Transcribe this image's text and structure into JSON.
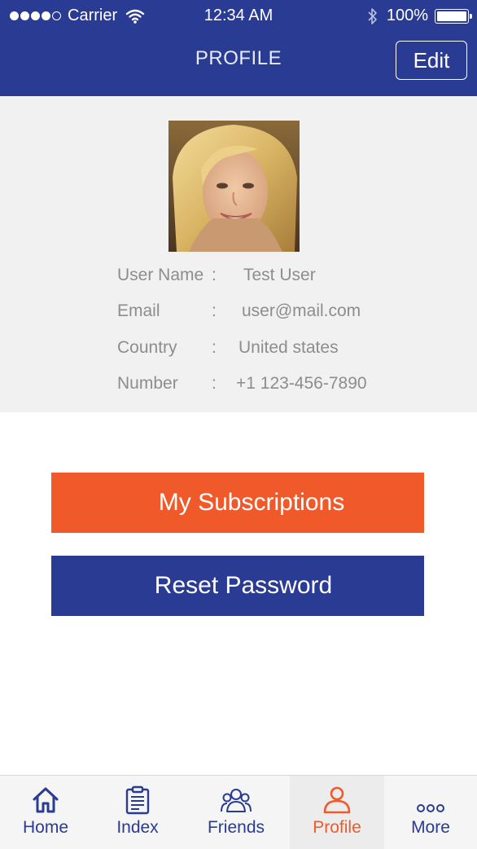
{
  "status_bar": {
    "carrier": "Carrier",
    "time": "12:34 AM",
    "battery": "100%"
  },
  "header": {
    "title": "PROFILE",
    "edit_label": "Edit"
  },
  "profile": {
    "fields": [
      {
        "label": "User Name",
        "sep": ":",
        "value": "Test User"
      },
      {
        "label": "Email",
        "sep": ":",
        "value": "user@mail.com"
      },
      {
        "label": "Country",
        "sep": ":",
        "value": "United states"
      },
      {
        "label": "Number",
        "sep": ":",
        "value": "+1 123-456-7890"
      }
    ]
  },
  "actions": {
    "subscriptions_label": "My Subscriptions",
    "reset_password_label": "Reset Password"
  },
  "tabbar": {
    "items": [
      {
        "label": "Home",
        "icon": "home-icon"
      },
      {
        "label": "Index",
        "icon": "clipboard-icon"
      },
      {
        "label": "Friends",
        "icon": "friends-icon"
      },
      {
        "label": "Profile",
        "icon": "user-icon",
        "active": true
      },
      {
        "label": "More",
        "icon": "more-icon"
      }
    ]
  },
  "colors": {
    "primary": "#293b92",
    "accent": "#f05a2a",
    "panel": "#f1f1f1"
  }
}
